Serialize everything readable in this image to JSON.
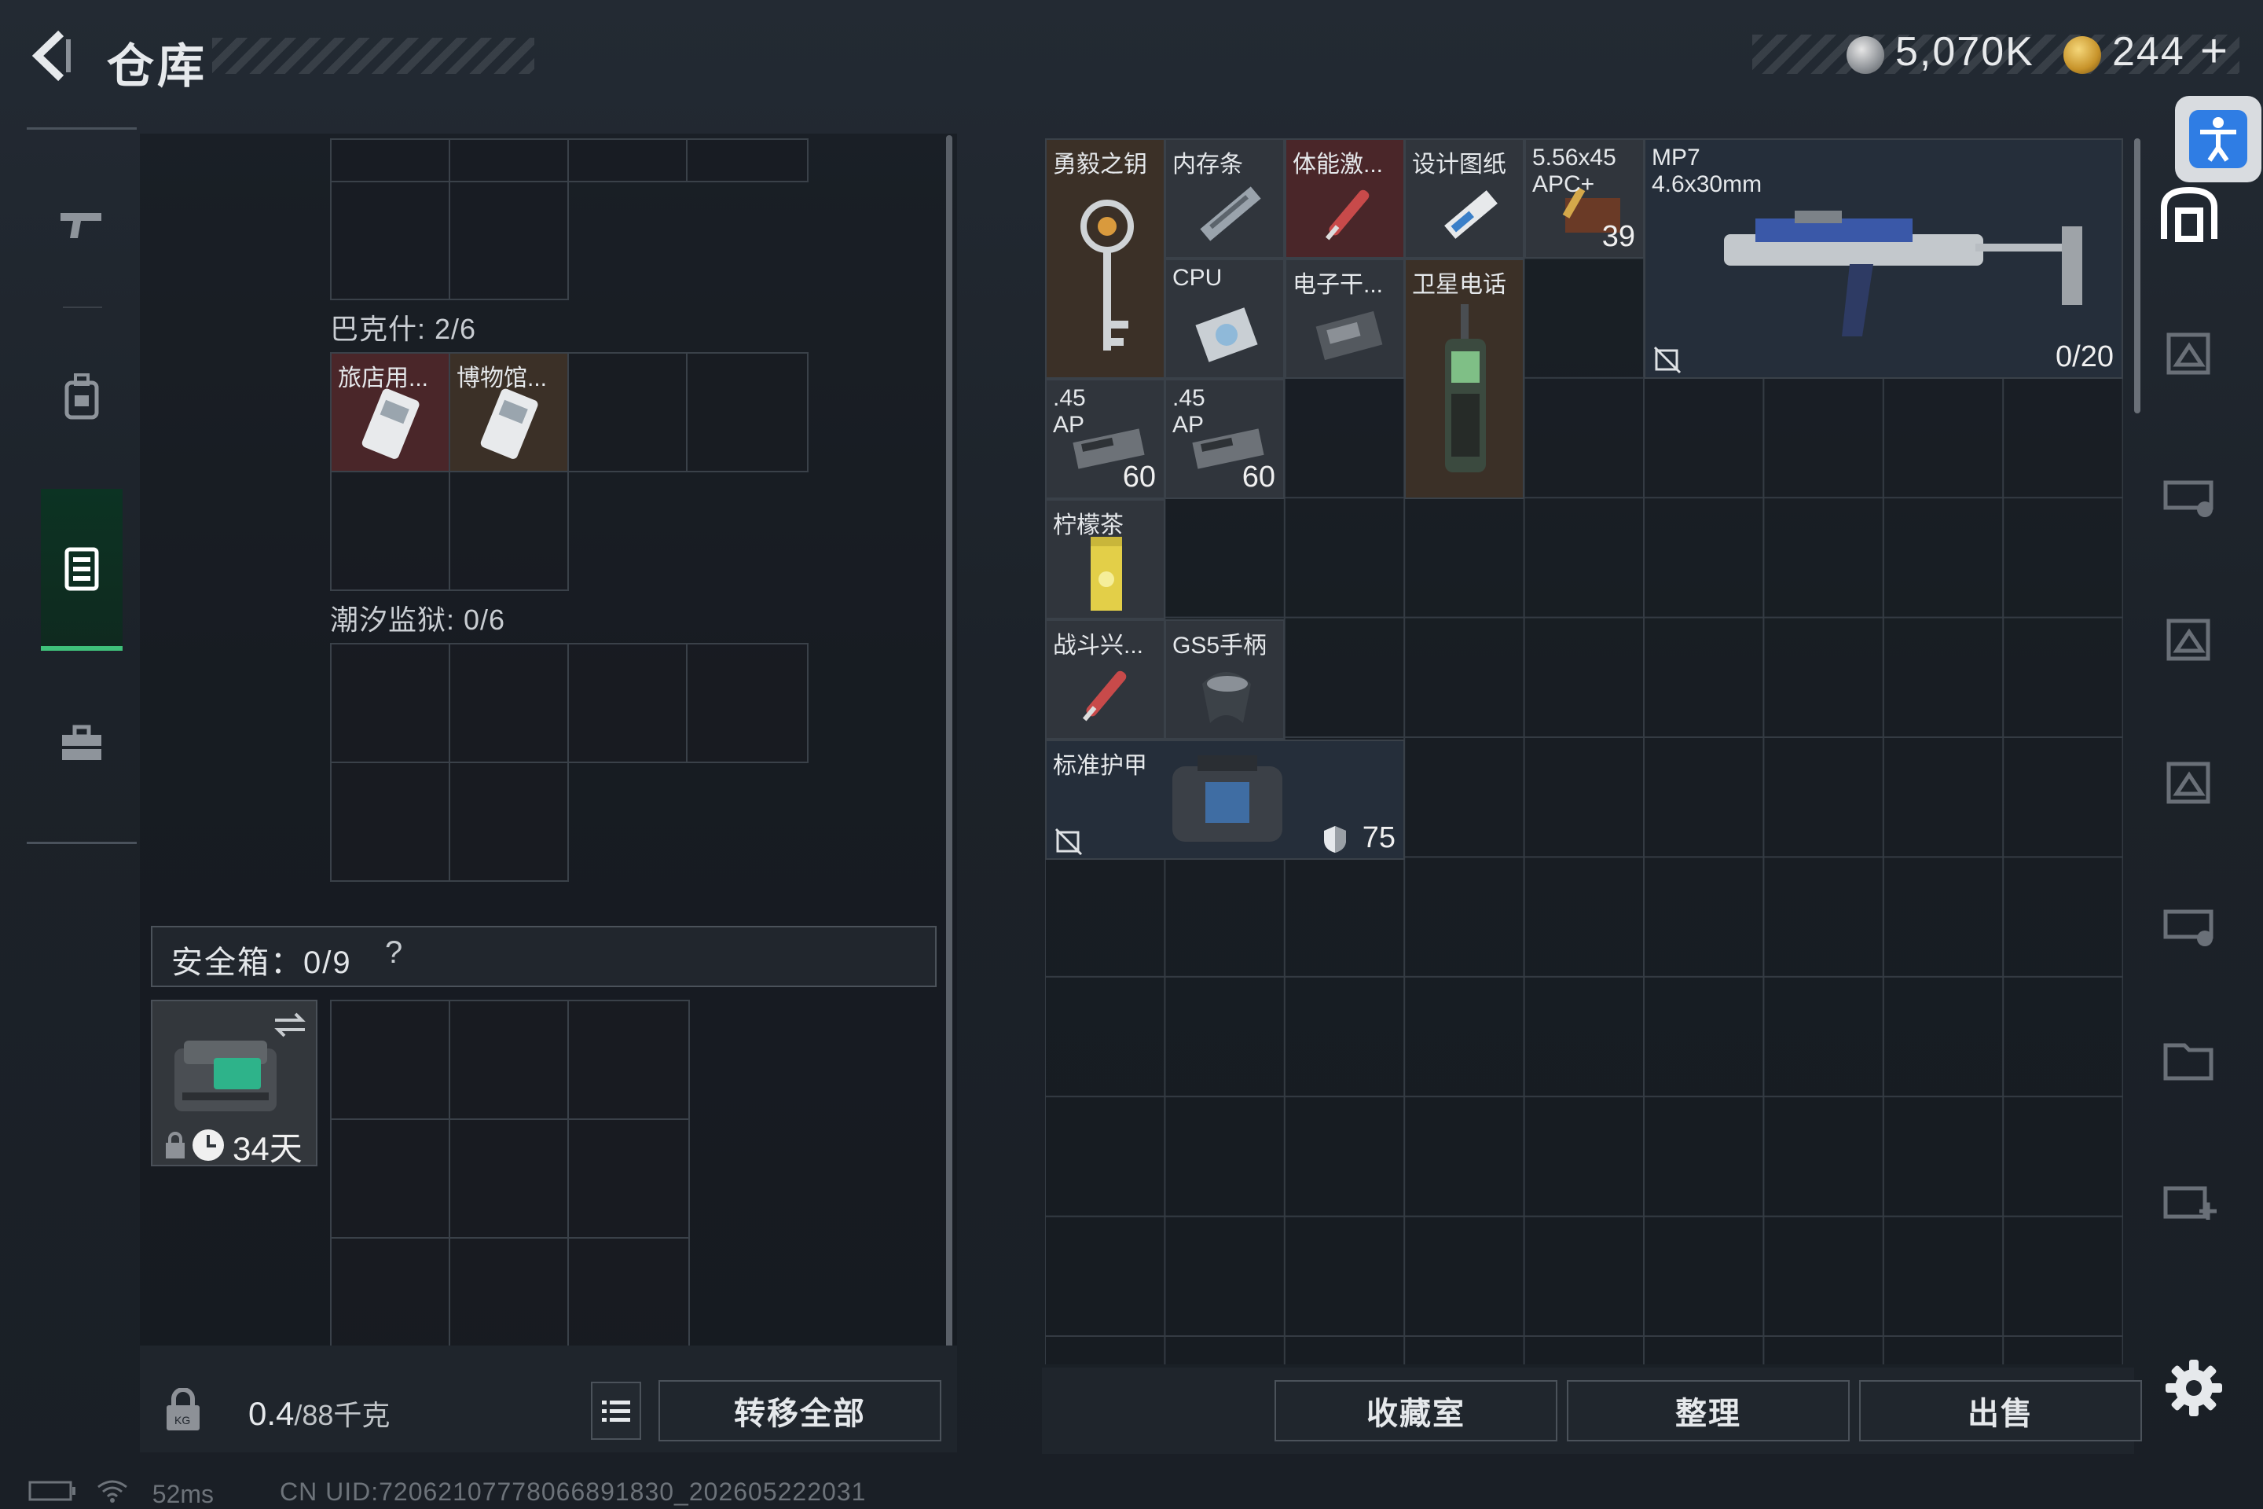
{
  "header": {
    "title": "仓库"
  },
  "currency": {
    "silver": "5,070K",
    "gold": "244",
    "plus": "+"
  },
  "icons": {
    "back": "back-arrow-icon",
    "pistol": "pistol-icon",
    "backpack": "backpack-icon",
    "locker": "locker-icon",
    "toolbox": "toolbox-icon",
    "lock": "lock-icon",
    "list": "list-icon",
    "settings": "gear-icon",
    "accessibility": "accessibility-icon",
    "swap": "swap-icon",
    "clock": "clock-icon",
    "shield": "shield-icon",
    "no_durability": "no-durability-icon"
  },
  "left_panel": {
    "section1": {
      "label": "巴克什: 2/6",
      "items": [
        "旅店用...",
        "博物馆..."
      ]
    },
    "section2": {
      "label": "潮汐监狱: 0/6"
    },
    "safe_box": {
      "label": "安全箱：0/9",
      "help": "?",
      "duration": "34天"
    },
    "weight": {
      "value": "0.4",
      "capacity": "/88千克"
    },
    "transfer_all": "转移全部"
  },
  "stash": {
    "items": {
      "key": {
        "name": "勇毅之钥"
      },
      "ram": {
        "name": "内存条"
      },
      "stim": {
        "name": "体能激..."
      },
      "blueprint": {
        "name": "设计图纸"
      },
      "ammo556": {
        "name": "5.56x45",
        "sub": "APC+",
        "count": "39"
      },
      "mp7": {
        "name": "MP7",
        "caliber": "4.6x30mm",
        "ammo": "0/20"
      },
      "cpu": {
        "name": "CPU"
      },
      "electronics": {
        "name": "电子干..."
      },
      "satphone": {
        "name": "卫星电话"
      },
      "ap45a": {
        "name": ".45",
        "sub": "AP",
        "count": "60"
      },
      "ap45b": {
        "name": ".45",
        "sub": "AP",
        "count": "60"
      },
      "tea": {
        "name": "柠檬茶"
      },
      "combat": {
        "name": "战斗兴..."
      },
      "grip": {
        "name": "GS5手柄"
      },
      "armor": {
        "name": "标准护甲",
        "durability": "75"
      }
    }
  },
  "buttons": {
    "collection": "收藏室",
    "organize": "整理",
    "sell": "出售"
  },
  "status": {
    "ping": "52ms",
    "uid": "CN UID:7206210777806689​1830_202605222031"
  },
  "colors": {
    "accent_green": "#3fc17a",
    "accent_blue": "#2f7de4"
  }
}
